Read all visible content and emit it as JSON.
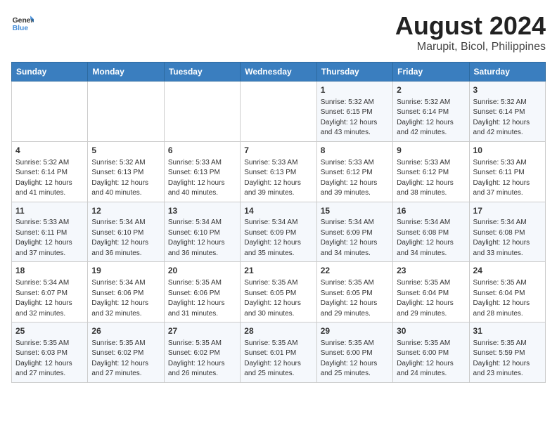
{
  "logo": {
    "line1": "General",
    "line2": "Blue"
  },
  "title": "August 2024",
  "subtitle": "Marupit, Bicol, Philippines",
  "days_of_week": [
    "Sunday",
    "Monday",
    "Tuesday",
    "Wednesday",
    "Thursday",
    "Friday",
    "Saturday"
  ],
  "weeks": [
    [
      {
        "day": "",
        "info": ""
      },
      {
        "day": "",
        "info": ""
      },
      {
        "day": "",
        "info": ""
      },
      {
        "day": "",
        "info": ""
      },
      {
        "day": "1",
        "info": "Sunrise: 5:32 AM\nSunset: 6:15 PM\nDaylight: 12 hours\nand 43 minutes."
      },
      {
        "day": "2",
        "info": "Sunrise: 5:32 AM\nSunset: 6:14 PM\nDaylight: 12 hours\nand 42 minutes."
      },
      {
        "day": "3",
        "info": "Sunrise: 5:32 AM\nSunset: 6:14 PM\nDaylight: 12 hours\nand 42 minutes."
      }
    ],
    [
      {
        "day": "4",
        "info": "Sunrise: 5:32 AM\nSunset: 6:14 PM\nDaylight: 12 hours\nand 41 minutes."
      },
      {
        "day": "5",
        "info": "Sunrise: 5:32 AM\nSunset: 6:13 PM\nDaylight: 12 hours\nand 40 minutes."
      },
      {
        "day": "6",
        "info": "Sunrise: 5:33 AM\nSunset: 6:13 PM\nDaylight: 12 hours\nand 40 minutes."
      },
      {
        "day": "7",
        "info": "Sunrise: 5:33 AM\nSunset: 6:13 PM\nDaylight: 12 hours\nand 39 minutes."
      },
      {
        "day": "8",
        "info": "Sunrise: 5:33 AM\nSunset: 6:12 PM\nDaylight: 12 hours\nand 39 minutes."
      },
      {
        "day": "9",
        "info": "Sunrise: 5:33 AM\nSunset: 6:12 PM\nDaylight: 12 hours\nand 38 minutes."
      },
      {
        "day": "10",
        "info": "Sunrise: 5:33 AM\nSunset: 6:11 PM\nDaylight: 12 hours\nand 37 minutes."
      }
    ],
    [
      {
        "day": "11",
        "info": "Sunrise: 5:33 AM\nSunset: 6:11 PM\nDaylight: 12 hours\nand 37 minutes."
      },
      {
        "day": "12",
        "info": "Sunrise: 5:34 AM\nSunset: 6:10 PM\nDaylight: 12 hours\nand 36 minutes."
      },
      {
        "day": "13",
        "info": "Sunrise: 5:34 AM\nSunset: 6:10 PM\nDaylight: 12 hours\nand 36 minutes."
      },
      {
        "day": "14",
        "info": "Sunrise: 5:34 AM\nSunset: 6:09 PM\nDaylight: 12 hours\nand 35 minutes."
      },
      {
        "day": "15",
        "info": "Sunrise: 5:34 AM\nSunset: 6:09 PM\nDaylight: 12 hours\nand 34 minutes."
      },
      {
        "day": "16",
        "info": "Sunrise: 5:34 AM\nSunset: 6:08 PM\nDaylight: 12 hours\nand 34 minutes."
      },
      {
        "day": "17",
        "info": "Sunrise: 5:34 AM\nSunset: 6:08 PM\nDaylight: 12 hours\nand 33 minutes."
      }
    ],
    [
      {
        "day": "18",
        "info": "Sunrise: 5:34 AM\nSunset: 6:07 PM\nDaylight: 12 hours\nand 32 minutes."
      },
      {
        "day": "19",
        "info": "Sunrise: 5:34 AM\nSunset: 6:06 PM\nDaylight: 12 hours\nand 32 minutes."
      },
      {
        "day": "20",
        "info": "Sunrise: 5:35 AM\nSunset: 6:06 PM\nDaylight: 12 hours\nand 31 minutes."
      },
      {
        "day": "21",
        "info": "Sunrise: 5:35 AM\nSunset: 6:05 PM\nDaylight: 12 hours\nand 30 minutes."
      },
      {
        "day": "22",
        "info": "Sunrise: 5:35 AM\nSunset: 6:05 PM\nDaylight: 12 hours\nand 29 minutes."
      },
      {
        "day": "23",
        "info": "Sunrise: 5:35 AM\nSunset: 6:04 PM\nDaylight: 12 hours\nand 29 minutes."
      },
      {
        "day": "24",
        "info": "Sunrise: 5:35 AM\nSunset: 6:04 PM\nDaylight: 12 hours\nand 28 minutes."
      }
    ],
    [
      {
        "day": "25",
        "info": "Sunrise: 5:35 AM\nSunset: 6:03 PM\nDaylight: 12 hours\nand 27 minutes."
      },
      {
        "day": "26",
        "info": "Sunrise: 5:35 AM\nSunset: 6:02 PM\nDaylight: 12 hours\nand 27 minutes."
      },
      {
        "day": "27",
        "info": "Sunrise: 5:35 AM\nSunset: 6:02 PM\nDaylight: 12 hours\nand 26 minutes."
      },
      {
        "day": "28",
        "info": "Sunrise: 5:35 AM\nSunset: 6:01 PM\nDaylight: 12 hours\nand 25 minutes."
      },
      {
        "day": "29",
        "info": "Sunrise: 5:35 AM\nSunset: 6:00 PM\nDaylight: 12 hours\nand 25 minutes."
      },
      {
        "day": "30",
        "info": "Sunrise: 5:35 AM\nSunset: 6:00 PM\nDaylight: 12 hours\nand 24 minutes."
      },
      {
        "day": "31",
        "info": "Sunrise: 5:35 AM\nSunset: 5:59 PM\nDaylight: 12 hours\nand 23 minutes."
      }
    ]
  ]
}
